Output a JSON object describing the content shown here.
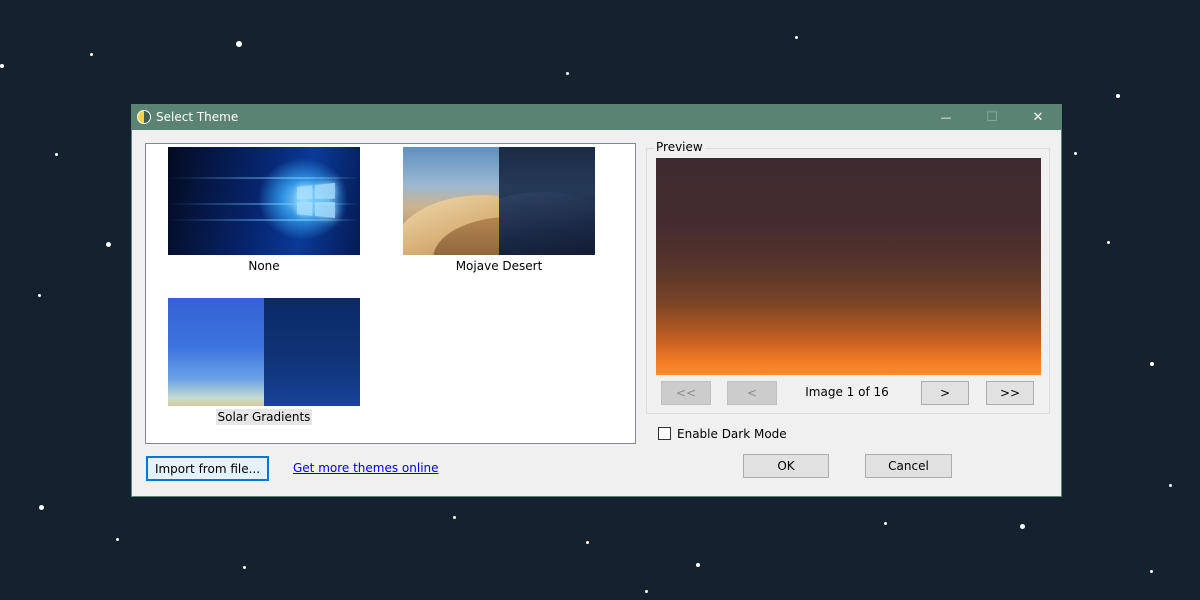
{
  "window": {
    "title": "Select Theme",
    "controls": {
      "minimize_glyph": "—",
      "maximize_glyph": "☐",
      "close_glyph": "✕"
    },
    "icons": [
      "app-icon",
      "minimize-icon",
      "maximize-icon",
      "close-icon"
    ]
  },
  "theme_list": {
    "items": [
      {
        "label": "None",
        "selected": false
      },
      {
        "label": "Mojave Desert",
        "selected": false
      },
      {
        "label": "Solar Gradients",
        "selected": true
      }
    ]
  },
  "preview": {
    "legend": "Preview",
    "nav": {
      "first": "<<",
      "prev": "<",
      "next": ">",
      "last": ">>"
    },
    "counter": "Image 1 of 16"
  },
  "options": {
    "dark_mode_label": "Enable Dark Mode",
    "dark_mode_checked": false
  },
  "actions": {
    "import_label": "Import from file...",
    "online_link": "Get more themes online",
    "ok_label": "OK",
    "cancel_label": "Cancel"
  },
  "colors": {
    "titlebar": "#5b8373",
    "desktop": "#142230",
    "link": "#0000ee",
    "focus": "#0078d7"
  }
}
